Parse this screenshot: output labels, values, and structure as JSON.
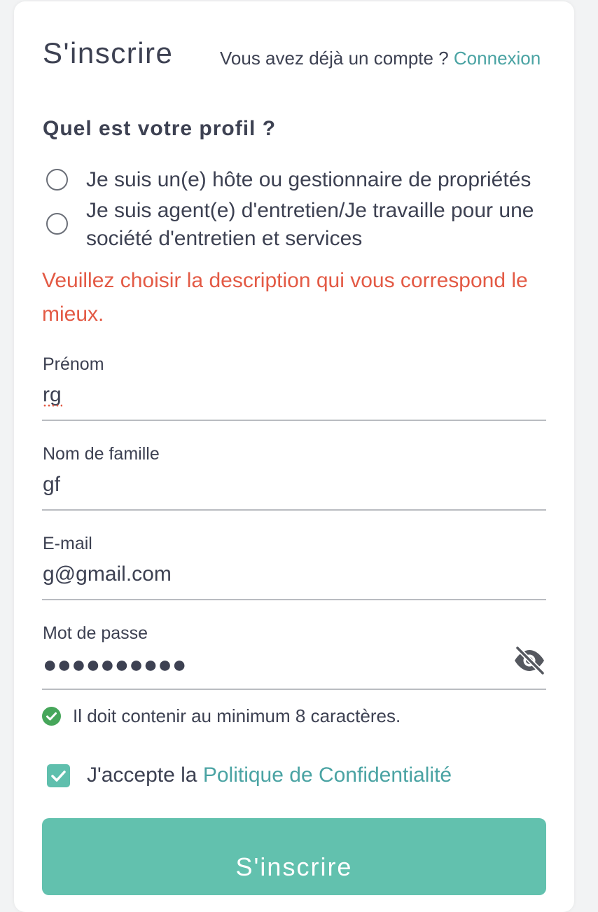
{
  "header": {
    "title": "S'inscrire",
    "have_account_text": "Vous avez déjà un compte ?",
    "login_link": "Connexion"
  },
  "profile": {
    "question": "Quel est votre profil ?",
    "options": [
      {
        "label": "Je suis un(e) hôte ou gestionnaire de propriétés",
        "selected": false
      },
      {
        "label": "Je suis agent(e) d'entretien/Je travaille pour une société d'entretien et services",
        "selected": false
      }
    ],
    "error": "Veuillez choisir la description qui vous correspond le mieux."
  },
  "fields": {
    "first_name": {
      "label": "Prénom",
      "value": "rg"
    },
    "last_name": {
      "label": "Nom de famille",
      "value": "gf"
    },
    "email": {
      "label": "E-mail",
      "value": "g@gmail.com"
    },
    "password": {
      "label": "Mot de passe",
      "masked": "●●●●●●●●●●"
    }
  },
  "password_rule": {
    "text": "Il doit contenir au minimum 8 caractères.",
    "satisfied": true
  },
  "consent": {
    "prefix": "J'accepte la",
    "link": "Politique de Confidentialité",
    "checked": true
  },
  "submit_label": "S'inscrire",
  "colors": {
    "accent": "#62c1ae",
    "link": "#4aa3a3",
    "error": "#e35a45",
    "text": "#3d4152",
    "success": "#46a65a"
  },
  "icons": {
    "password_toggle": "eye-slash-icon",
    "rule_status": "check-circle-icon",
    "consent_checkbox": "checkbox-checked-icon"
  }
}
